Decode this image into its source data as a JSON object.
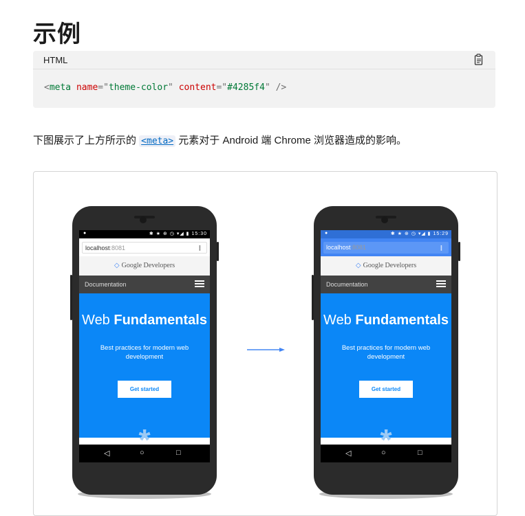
{
  "heading": "示例",
  "code": {
    "language": "HTML",
    "lt": "<",
    "tag": "meta",
    "attr1_name": "name",
    "eq_q1": "=\"",
    "attr1_value": "theme-color",
    "q_sp": "\" ",
    "attr2_name": "content",
    "eq_q2": "=\"",
    "attr2_value": "#4285f4",
    "close": "\" />"
  },
  "description": {
    "before": "下图展示了上方所示的 ",
    "code": "<meta>",
    "after": " 元素对于 Android 端 Chrome 浏览器造成的影响。"
  },
  "phones": [
    {
      "status_time": "15:30",
      "status_icons": "✱ ★ ⊕ ◷ ▾◢ ▮",
      "status_left": "●",
      "url_host": "localhost",
      "url_port": ":8081",
      "addr_menu": "⋮",
      "brand": "Google Developers",
      "brand_logo": "◇",
      "doc_label": "Documentation",
      "hero_title_light": "Web ",
      "hero_title_bold": "Fundamentals",
      "hero_sub": "Best practices for modern web development",
      "cta": "Get started",
      "asterisk": "*",
      "nav_back": "◁",
      "nav_home": "○",
      "nav_recent": "□",
      "toolbar_color": "#ffffff",
      "input_color": "#ffffff",
      "url_color": "#333333",
      "menu_color": "#555555"
    },
    {
      "status_time": "15:29",
      "status_icons": "✱ ★ ⊕ ◷ ▾◢ ▮",
      "status_left": "●",
      "url_host": "localhost",
      "url_port": ":8081",
      "addr_menu": "⋮",
      "brand": "Google Developers",
      "brand_logo": "◇",
      "doc_label": "Documentation",
      "hero_title_light": "Web ",
      "hero_title_bold": "Fundamentals",
      "hero_sub": "Best practices for modern web development",
      "cta": "Get started",
      "asterisk": "*",
      "nav_back": "◁",
      "nav_home": "○",
      "nav_recent": "□",
      "toolbar_color": "#4285f4",
      "input_color": "#5c97f6",
      "url_color": "#ffffff",
      "menu_color": "#ffffff"
    }
  ],
  "colors": {
    "theme_color": "#4285f4",
    "hero_blue": "#0b87f7"
  }
}
